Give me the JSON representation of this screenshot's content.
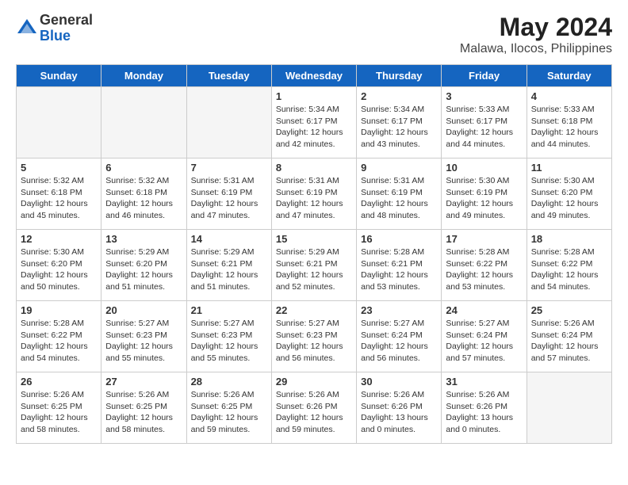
{
  "header": {
    "logo_general": "General",
    "logo_blue": "Blue",
    "main_title": "May 2024",
    "subtitle": "Malawa, Ilocos, Philippines"
  },
  "days_of_week": [
    "Sunday",
    "Monday",
    "Tuesday",
    "Wednesday",
    "Thursday",
    "Friday",
    "Saturday"
  ],
  "weeks": [
    [
      {
        "date": "",
        "info": ""
      },
      {
        "date": "",
        "info": ""
      },
      {
        "date": "",
        "info": ""
      },
      {
        "date": "1",
        "info": "Sunrise: 5:34 AM\nSunset: 6:17 PM\nDaylight: 12 hours\nand 42 minutes."
      },
      {
        "date": "2",
        "info": "Sunrise: 5:34 AM\nSunset: 6:17 PM\nDaylight: 12 hours\nand 43 minutes."
      },
      {
        "date": "3",
        "info": "Sunrise: 5:33 AM\nSunset: 6:17 PM\nDaylight: 12 hours\nand 44 minutes."
      },
      {
        "date": "4",
        "info": "Sunrise: 5:33 AM\nSunset: 6:18 PM\nDaylight: 12 hours\nand 44 minutes."
      }
    ],
    [
      {
        "date": "5",
        "info": "Sunrise: 5:32 AM\nSunset: 6:18 PM\nDaylight: 12 hours\nand 45 minutes."
      },
      {
        "date": "6",
        "info": "Sunrise: 5:32 AM\nSunset: 6:18 PM\nDaylight: 12 hours\nand 46 minutes."
      },
      {
        "date": "7",
        "info": "Sunrise: 5:31 AM\nSunset: 6:19 PM\nDaylight: 12 hours\nand 47 minutes."
      },
      {
        "date": "8",
        "info": "Sunrise: 5:31 AM\nSunset: 6:19 PM\nDaylight: 12 hours\nand 47 minutes."
      },
      {
        "date": "9",
        "info": "Sunrise: 5:31 AM\nSunset: 6:19 PM\nDaylight: 12 hours\nand 48 minutes."
      },
      {
        "date": "10",
        "info": "Sunrise: 5:30 AM\nSunset: 6:19 PM\nDaylight: 12 hours\nand 49 minutes."
      },
      {
        "date": "11",
        "info": "Sunrise: 5:30 AM\nSunset: 6:20 PM\nDaylight: 12 hours\nand 49 minutes."
      }
    ],
    [
      {
        "date": "12",
        "info": "Sunrise: 5:30 AM\nSunset: 6:20 PM\nDaylight: 12 hours\nand 50 minutes."
      },
      {
        "date": "13",
        "info": "Sunrise: 5:29 AM\nSunset: 6:20 PM\nDaylight: 12 hours\nand 51 minutes."
      },
      {
        "date": "14",
        "info": "Sunrise: 5:29 AM\nSunset: 6:21 PM\nDaylight: 12 hours\nand 51 minutes."
      },
      {
        "date": "15",
        "info": "Sunrise: 5:29 AM\nSunset: 6:21 PM\nDaylight: 12 hours\nand 52 minutes."
      },
      {
        "date": "16",
        "info": "Sunrise: 5:28 AM\nSunset: 6:21 PM\nDaylight: 12 hours\nand 53 minutes."
      },
      {
        "date": "17",
        "info": "Sunrise: 5:28 AM\nSunset: 6:22 PM\nDaylight: 12 hours\nand 53 minutes."
      },
      {
        "date": "18",
        "info": "Sunrise: 5:28 AM\nSunset: 6:22 PM\nDaylight: 12 hours\nand 54 minutes."
      }
    ],
    [
      {
        "date": "19",
        "info": "Sunrise: 5:28 AM\nSunset: 6:22 PM\nDaylight: 12 hours\nand 54 minutes."
      },
      {
        "date": "20",
        "info": "Sunrise: 5:27 AM\nSunset: 6:23 PM\nDaylight: 12 hours\nand 55 minutes."
      },
      {
        "date": "21",
        "info": "Sunrise: 5:27 AM\nSunset: 6:23 PM\nDaylight: 12 hours\nand 55 minutes."
      },
      {
        "date": "22",
        "info": "Sunrise: 5:27 AM\nSunset: 6:23 PM\nDaylight: 12 hours\nand 56 minutes."
      },
      {
        "date": "23",
        "info": "Sunrise: 5:27 AM\nSunset: 6:24 PM\nDaylight: 12 hours\nand 56 minutes."
      },
      {
        "date": "24",
        "info": "Sunrise: 5:27 AM\nSunset: 6:24 PM\nDaylight: 12 hours\nand 57 minutes."
      },
      {
        "date": "25",
        "info": "Sunrise: 5:26 AM\nSunset: 6:24 PM\nDaylight: 12 hours\nand 57 minutes."
      }
    ],
    [
      {
        "date": "26",
        "info": "Sunrise: 5:26 AM\nSunset: 6:25 PM\nDaylight: 12 hours\nand 58 minutes."
      },
      {
        "date": "27",
        "info": "Sunrise: 5:26 AM\nSunset: 6:25 PM\nDaylight: 12 hours\nand 58 minutes."
      },
      {
        "date": "28",
        "info": "Sunrise: 5:26 AM\nSunset: 6:25 PM\nDaylight: 12 hours\nand 59 minutes."
      },
      {
        "date": "29",
        "info": "Sunrise: 5:26 AM\nSunset: 6:26 PM\nDaylight: 12 hours\nand 59 minutes."
      },
      {
        "date": "30",
        "info": "Sunrise: 5:26 AM\nSunset: 6:26 PM\nDaylight: 13 hours\nand 0 minutes."
      },
      {
        "date": "31",
        "info": "Sunrise: 5:26 AM\nSunset: 6:26 PM\nDaylight: 13 hours\nand 0 minutes."
      },
      {
        "date": "",
        "info": ""
      }
    ]
  ]
}
